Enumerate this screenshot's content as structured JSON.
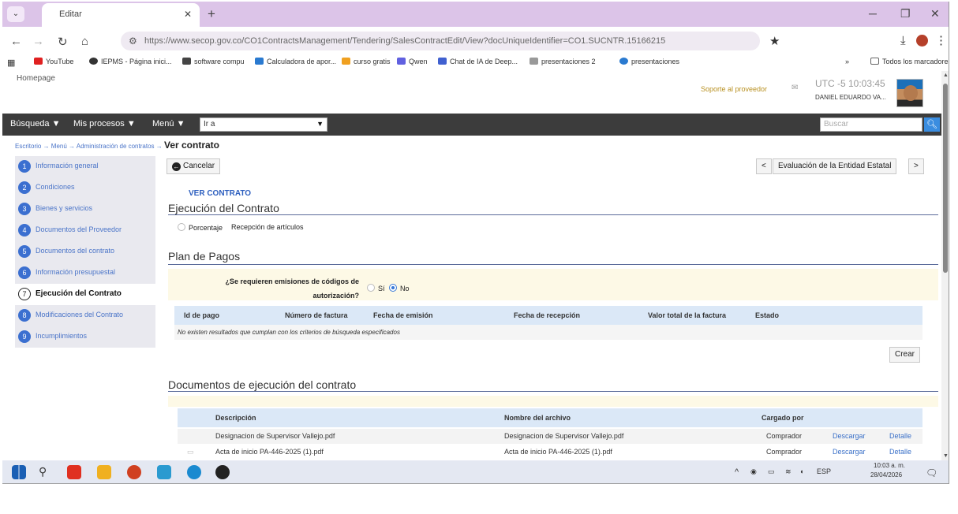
{
  "browser": {
    "tab_title": "Editar",
    "url": "https://www.secop.gov.co/CO1ContractsManagement/Tendering/SalesContractEdit/View?docUniqueIdentifier=CO1.SUCNTR.15166215",
    "bookmarks": [
      {
        "label": "YouTube",
        "color": "#e02020"
      },
      {
        "label": "IEPMS - Página inici...",
        "color": "#333333"
      },
      {
        "label": "software compu",
        "color": "#444444"
      },
      {
        "label": "Calculadora de apor...",
        "color": "#2a7ad0"
      },
      {
        "label": "curso gratis",
        "color": "#f0a020"
      },
      {
        "label": "Qwen",
        "color": "#6060e0"
      },
      {
        "label": "Chat de IA de Deep...",
        "color": "#4060d0"
      },
      {
        "label": "presentaciones 2",
        "color": "#999999"
      },
      {
        "label": "presentaciones",
        "color": "#2a7ad0"
      }
    ],
    "all_bookmarks": "Todos los marcadores"
  },
  "header": {
    "homepage": "Homepage",
    "user_link": "Soporte al proveedor",
    "clock": "UTC -5 10:03:45",
    "username": "DANIEL EDUARDO VA..."
  },
  "nav": {
    "search_menu": "Búsqueda ▼",
    "my_processes": "Mis procesos ▼",
    "menu": "Menú ▼",
    "goto_value": "Ir a",
    "search_placeholder": "Buscar"
  },
  "breadcrumb": {
    "path": "Escritorio → Menú → Administración de contratos →",
    "current": "Ver contrato"
  },
  "sidebar": {
    "items": [
      {
        "num": "1",
        "label": "Información general"
      },
      {
        "num": "2",
        "label": "Condiciones"
      },
      {
        "num": "3",
        "label": "Bienes y servicios"
      },
      {
        "num": "4",
        "label": "Documentos del Proveedor"
      },
      {
        "num": "5",
        "label": "Documentos del contrato"
      },
      {
        "num": "6",
        "label": "Información presupuestal"
      },
      {
        "num": "7",
        "label": "Ejecución del Contrato"
      },
      {
        "num": "8",
        "label": "Modificaciones del Contrato"
      },
      {
        "num": "9",
        "label": "Incumplimientos"
      }
    ]
  },
  "main": {
    "cancel_label": "Cancelar",
    "prev_label": "<",
    "next_label": ">",
    "evaluation_label": "Evaluación de la Entidad Estatal",
    "ver_contrato": "VER CONTRATO",
    "execution_title": "Ejecución del Contrato",
    "opt_percentage": "Porcentaje",
    "opt_reception": "Recepción de artículos",
    "payment_plan_title": "Plan de Pagos",
    "question": "¿Se requieren emisiones de códigos de autorización?",
    "opt_si": "Sí",
    "opt_no": "No",
    "payments_table": {
      "headers": [
        "Id de pago",
        "Número de factura",
        "Fecha de emisión",
        "Fecha de recepción",
        "Valor total de la factura",
        "Estado"
      ],
      "empty_message": "No existen resultados que cumplan con los criterios de búsqueda especificados"
    },
    "create_label": "Crear",
    "docs_title": "Documentos de ejecución del contrato",
    "docs_table": {
      "headers": [
        "Descripción",
        "Nombre del archivo",
        "Cargado por"
      ],
      "rows": [
        {
          "description": "Designacion de Supervisor Vallejo.pdf",
          "file": "Designacion de Supervisor Vallejo.pdf",
          "uploaded_by": "Comprador",
          "download": "Descargar",
          "detail": "Detalle"
        },
        {
          "description": "Acta de inicio PA-446-2025 (1).pdf",
          "file": "Acta de inicio PA-446-2025 (1).pdf",
          "uploaded_by": "Comprador",
          "download": "Descargar",
          "detail": "Detalle"
        }
      ]
    }
  },
  "taskbar": {
    "tray_lang": "ESP",
    "time": "10:03 a. m.",
    "date": "28/04/2026"
  }
}
